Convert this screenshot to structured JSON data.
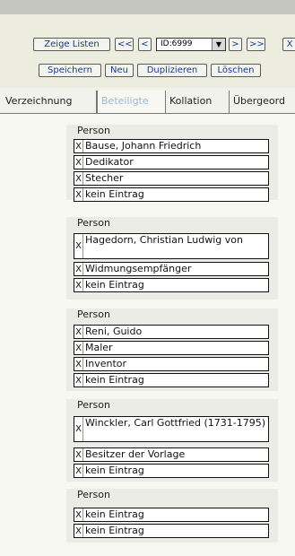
{
  "toolbar": {
    "show_lists": "Zeige Listen",
    "first": "<<",
    "prev": "<",
    "record_id": "ID:6999",
    "next": ">",
    "last": ">>",
    "close": "X",
    "save": "Speichern",
    "new": "Neu",
    "duplicate": "Duplizieren",
    "delete": "Löschen"
  },
  "tabs": [
    "Verzeichnung",
    "Beteiligte",
    "Kollation",
    "Übergeord"
  ],
  "active_tab": "Beteiligte",
  "groups": [
    {
      "label": "Person",
      "entries": [
        "Bause, Johann Friedrich",
        "Dedikator",
        "Stecher",
        "kein Eintrag"
      ]
    },
    {
      "label": "Person",
      "entries": [
        "Hagedorn, Christian Ludwig von",
        "Widmungsempfänger",
        "kein Eintrag"
      ]
    },
    {
      "label": "Person",
      "entries": [
        "Reni, Guido",
        "Maler",
        "Inventor",
        "kein Eintrag"
      ]
    },
    {
      "label": "Person",
      "entries": [
        "Winckler, Carl Gottfried (1731-1795)",
        "Besitzer der Vorlage",
        "kein Eintrag"
      ]
    },
    {
      "label": "Person",
      "entries": [
        "kein Eintrag",
        "kein Eintrag"
      ]
    }
  ]
}
